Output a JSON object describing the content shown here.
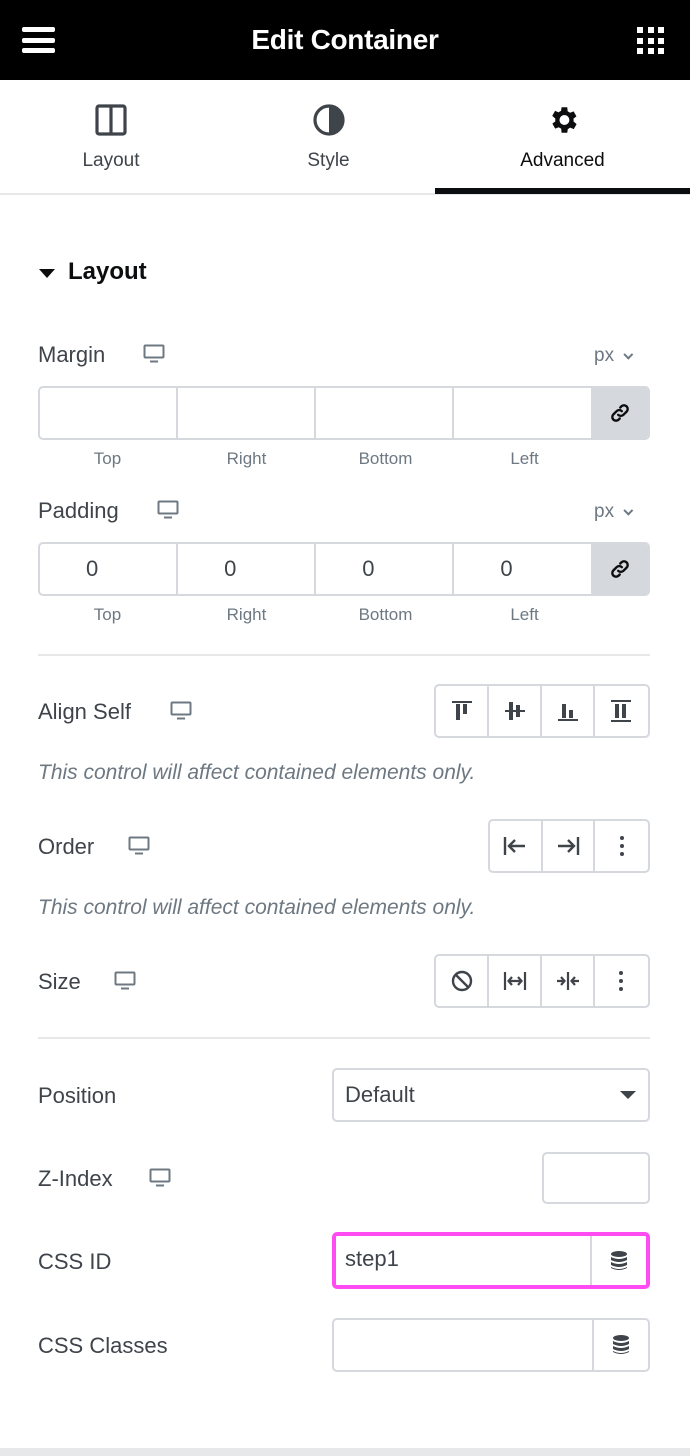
{
  "header": {
    "title": "Edit Container",
    "menu_icon": "hamburger-menu-icon",
    "apps_icon": "grid-apps-icon",
    "background": "#000000"
  },
  "tabs": [
    {
      "label": "Layout",
      "icon": "columns-layout-icon",
      "active": false
    },
    {
      "label": "Style",
      "icon": "half-circle-contrast-icon",
      "active": false
    },
    {
      "label": "Advanced",
      "icon": "gear-icon",
      "active": true
    }
  ],
  "section": {
    "title": "Layout",
    "expanded": true
  },
  "margin": {
    "label": "Margin",
    "unit": "px",
    "values": [
      "",
      "",
      "",
      ""
    ],
    "sides": [
      "Top",
      "Right",
      "Bottom",
      "Left"
    ],
    "linked": true
  },
  "padding": {
    "label": "Padding",
    "unit": "px",
    "values": [
      "0",
      "0",
      "0",
      "0"
    ],
    "sides": [
      "Top",
      "Right",
      "Bottom",
      "Left"
    ],
    "linked": true
  },
  "align_self": {
    "label": "Align Self",
    "note": "This control will affect contained elements only.",
    "options": [
      "align-start-icon",
      "align-center-icon",
      "align-end-icon",
      "align-stretch-icon"
    ]
  },
  "order": {
    "label": "Order",
    "note": "This control will affect contained elements only.",
    "options": [
      "order-start-icon",
      "order-end-icon",
      "more-dots-icon"
    ]
  },
  "size": {
    "label": "Size",
    "options": [
      "none-icon",
      "grow-icon",
      "shrink-icon",
      "more-dots-icon"
    ]
  },
  "position": {
    "label": "Position",
    "selected": "Default"
  },
  "z_index": {
    "label": "Z-Index",
    "value": ""
  },
  "css_id": {
    "label": "CSS ID",
    "value": "step1",
    "highlight_color": "#ff4cf2"
  },
  "css_classes": {
    "label": "CSS Classes",
    "value": ""
  }
}
